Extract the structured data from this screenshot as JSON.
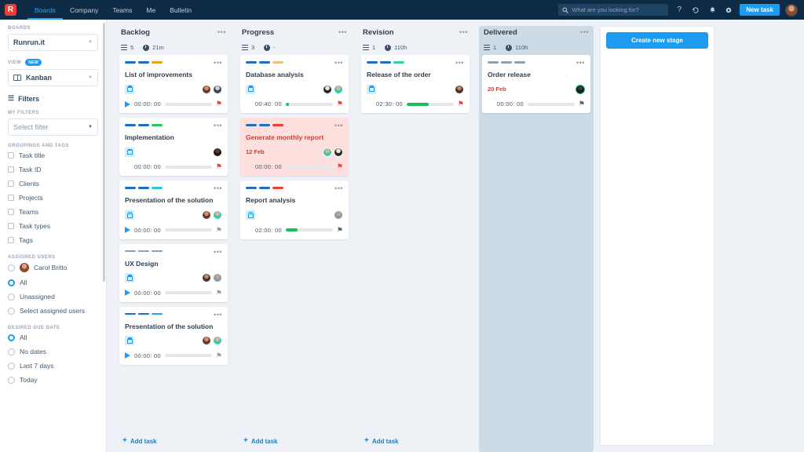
{
  "topbar": {
    "logo": "R",
    "nav": [
      {
        "label": "Boards",
        "active": true
      },
      {
        "label": "Company",
        "active": false
      },
      {
        "label": "Teams",
        "active": false
      },
      {
        "label": "Me",
        "active": false
      },
      {
        "label": "Bulletin",
        "active": false
      }
    ],
    "search_placeholder": "What are you looking for?",
    "icons": [
      "search-icon",
      "help-icon",
      "history-icon",
      "bell-icon",
      "gear-icon"
    ],
    "help": "?",
    "history": "↺",
    "bell": "✉",
    "gear": "⚙",
    "new_task": "New task"
  },
  "sidebar": {
    "boards_label": "BOARDS",
    "board_value": "Runrun.it",
    "view_label": "VIEW",
    "view_badge": "NEW",
    "view_value": "Kanban",
    "filters_label": "Filters",
    "my_filters_label": "MY FILTERS",
    "select_filter_placeholder": "Select filter",
    "groupings_label": "GROUPINGS AND TAGS",
    "groupings": [
      {
        "label": "Task title"
      },
      {
        "label": "Task ID"
      },
      {
        "label": "Clients"
      },
      {
        "label": "Projects"
      },
      {
        "label": "Teams"
      },
      {
        "label": "Task types"
      },
      {
        "label": "Tags"
      }
    ],
    "assigned_users_label": "ASSIGNED USERS",
    "assigned_users": [
      {
        "label": "Carol Britto",
        "selected": false,
        "avatar": true
      },
      {
        "label": "All",
        "selected": true,
        "avatar": false
      },
      {
        "label": "Unassigned",
        "selected": false,
        "avatar": false
      },
      {
        "label": "Select assigned users",
        "selected": false,
        "avatar": false
      }
    ],
    "due_date_label": "DESIRED DUE DATE",
    "due_dates": [
      {
        "label": "All",
        "selected": true
      },
      {
        "label": "No dates",
        "selected": false
      },
      {
        "label": "Last 7 days",
        "selected": false
      },
      {
        "label": "Today",
        "selected": false
      }
    ]
  },
  "board": {
    "add_task_label": "Add task",
    "create_stage_label": "Create new stage",
    "columns": [
      {
        "title": "Backlog",
        "count": "5",
        "duration": "21m",
        "dropzone": false,
        "add_task": true,
        "cards": [
          {
            "title": "List of improvements",
            "segments": [
              "#1b6ec2",
              "#1b6ec2",
              "#e8a317"
            ],
            "time": "00:00: 00",
            "progress": 0,
            "flag": "red",
            "play": true,
            "overdue": false,
            "due": "",
            "calendar": true,
            "avatars": [
              "a1",
              "a2"
            ]
          },
          {
            "title": "Implementation",
            "segments": [
              "#1b6ec2",
              "#1b6ec2",
              "#22c55e"
            ],
            "time": "00:00: 00",
            "progress": 0,
            "flag": "red",
            "play": false,
            "overdue": false,
            "due": "",
            "calendar": true,
            "avatars": [
              "a4"
            ]
          },
          {
            "title": "Presentation of the solution",
            "segments": [
              "#1b6ec2",
              "#1b6ec2",
              "#2ec5d3"
            ],
            "time": "00:00: 00",
            "progress": 0,
            "flag": "gray",
            "play": true,
            "overdue": false,
            "due": "",
            "calendar": true,
            "avatars": [
              "a1",
              "a3"
            ]
          },
          {
            "title": "UX Design",
            "segments": [
              "#8fa0b0",
              "#8fa0b0",
              "#8fa0b0"
            ],
            "time": "00:00: 00",
            "progress": 0,
            "flag": "gray",
            "play": true,
            "overdue": false,
            "due": "",
            "calendar": true,
            "avatars": [
              "a7",
              "a6"
            ]
          },
          {
            "title": "Presentation of the solution",
            "segments": [
              "#1b6ec2",
              "#1b6ec2",
              "#2ea2f0"
            ],
            "time": "00:00: 00",
            "progress": 0,
            "flag": "gray",
            "play": true,
            "overdue": false,
            "due": "",
            "calendar": true,
            "avatars": [
              "a1",
              "a3"
            ]
          }
        ]
      },
      {
        "title": "Progress",
        "count": "3",
        "duration": "-",
        "dropzone": false,
        "add_task": true,
        "cards": [
          {
            "title": "Database analysis",
            "segments": [
              "#1b6ec2",
              "#1b6ec2",
              "#e8c17a"
            ],
            "time": "00:40: 00",
            "progress": 6,
            "flag": "red",
            "play": false,
            "overdue": false,
            "due": "",
            "calendar": true,
            "avatars": [
              "a5",
              "a3"
            ]
          },
          {
            "title": "Generate monthly report",
            "segments": [
              "#1b6ec2",
              "#1b6ec2",
              "#ef3d33"
            ],
            "time": "00:00: 00",
            "progress": 0,
            "flag": "red",
            "play": false,
            "overdue": true,
            "due": "12 Feb",
            "calendar": false,
            "avatars": [
              "a3",
              "a5"
            ]
          },
          {
            "title": "Report analysis",
            "segments": [
              "#1b6ec2",
              "#1b6ec2",
              "#ef3d33"
            ],
            "time": "02:00: 00",
            "progress": 25,
            "flag": "dark",
            "play": false,
            "overdue": false,
            "due": "",
            "calendar": true,
            "avatars": [
              "a6"
            ]
          }
        ]
      },
      {
        "title": "Revision",
        "count": "1",
        "duration": "110h",
        "dropzone": false,
        "add_task": true,
        "cards": [
          {
            "title": "Release of the order",
            "segments": [
              "#1b6ec2",
              "#1b6ec2",
              "#2ed3a0"
            ],
            "time": "02:30: 00",
            "progress": 47,
            "flag": "red",
            "play": false,
            "overdue": false,
            "due": "",
            "calendar": true,
            "avatars": [
              "a7"
            ]
          }
        ]
      },
      {
        "title": "Delivered",
        "count": "1",
        "duration": "110h",
        "dropzone": true,
        "add_task": false,
        "cards": [
          {
            "title": "Order release",
            "segments": [
              "#8fa0b0",
              "#8fa0b0",
              "#8fa0b0"
            ],
            "time": "00:00: 00",
            "progress": 0,
            "flag": "dark",
            "play": false,
            "overdue": false,
            "due": "20 Feb",
            "calendar": false,
            "avatars": [
              "a8"
            ]
          }
        ]
      }
    ]
  }
}
